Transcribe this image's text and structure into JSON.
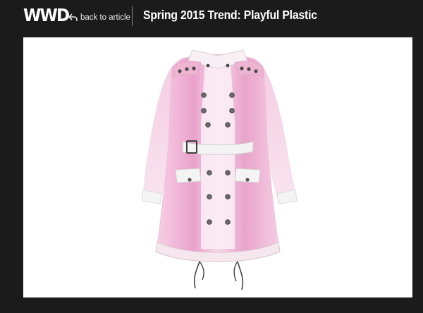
{
  "header": {
    "logo_text": "WWD",
    "back_label": "back to article",
    "title": "Spring 2015 Trend: Playful  Plastic"
  },
  "image": {
    "subject_icon": "trench-coat-image",
    "colors": {
      "coat": "#f0b6d6",
      "coat_dark": "#e28fc0",
      "inner": "#fbe9f2",
      "button": "#5a5a5a"
    }
  },
  "colors": {
    "background": "#1b1b1b",
    "text": "#ffffff",
    "frame": "#ffffff"
  }
}
